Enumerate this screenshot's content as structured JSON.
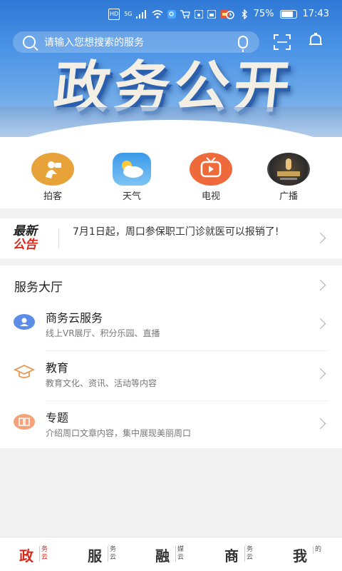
{
  "status_bar": {
    "network": "5G",
    "battery": "75%",
    "time": "17:43"
  },
  "search": {
    "placeholder": "请输入您想搜索的服务"
  },
  "banner": {
    "title": "政务公开"
  },
  "quick_links": [
    {
      "label": "拍客",
      "icon": "camera-person-icon",
      "color": "#e8a23a"
    },
    {
      "label": "天气",
      "icon": "cloud-sun-icon",
      "color": "#3b9ae8"
    },
    {
      "label": "电视",
      "icon": "tv-icon",
      "color": "#ef6a3a"
    },
    {
      "label": "广播",
      "icon": "microphone-icon",
      "color": "#3a3a3a"
    }
  ],
  "notice": {
    "logo_line1": "最新",
    "logo_line2": "公告",
    "text": "7月1日起，周口参保职工门诊就医可以报销了!"
  },
  "service_hall": {
    "title": "服务大厅",
    "items": [
      {
        "title": "商务云服务",
        "subtitle": "线上VR展厅、积分乐园、直播",
        "icon": "user-card-icon",
        "color": "#5b8de8"
      },
      {
        "title": "教育",
        "subtitle": "教育文化、资讯、活动等内容",
        "icon": "graduation-cap-icon",
        "color": "#e89a5a"
      },
      {
        "title": "专题",
        "subtitle": "介绍周口文章内容，集中展现美丽周口",
        "icon": "book-icon",
        "color": "#ef7a45"
      }
    ]
  },
  "bottom_nav": [
    {
      "big": "政",
      "small": "务云",
      "active": true
    },
    {
      "big": "服",
      "small": "务云",
      "active": false
    },
    {
      "big": "融",
      "small": "媒云",
      "active": false
    },
    {
      "big": "商",
      "small": "务云",
      "active": false
    },
    {
      "big": "我",
      "small": "的",
      "active": false
    }
  ],
  "colors": {
    "accent": "#d62a1d",
    "banner_blue": "#3a86df"
  }
}
